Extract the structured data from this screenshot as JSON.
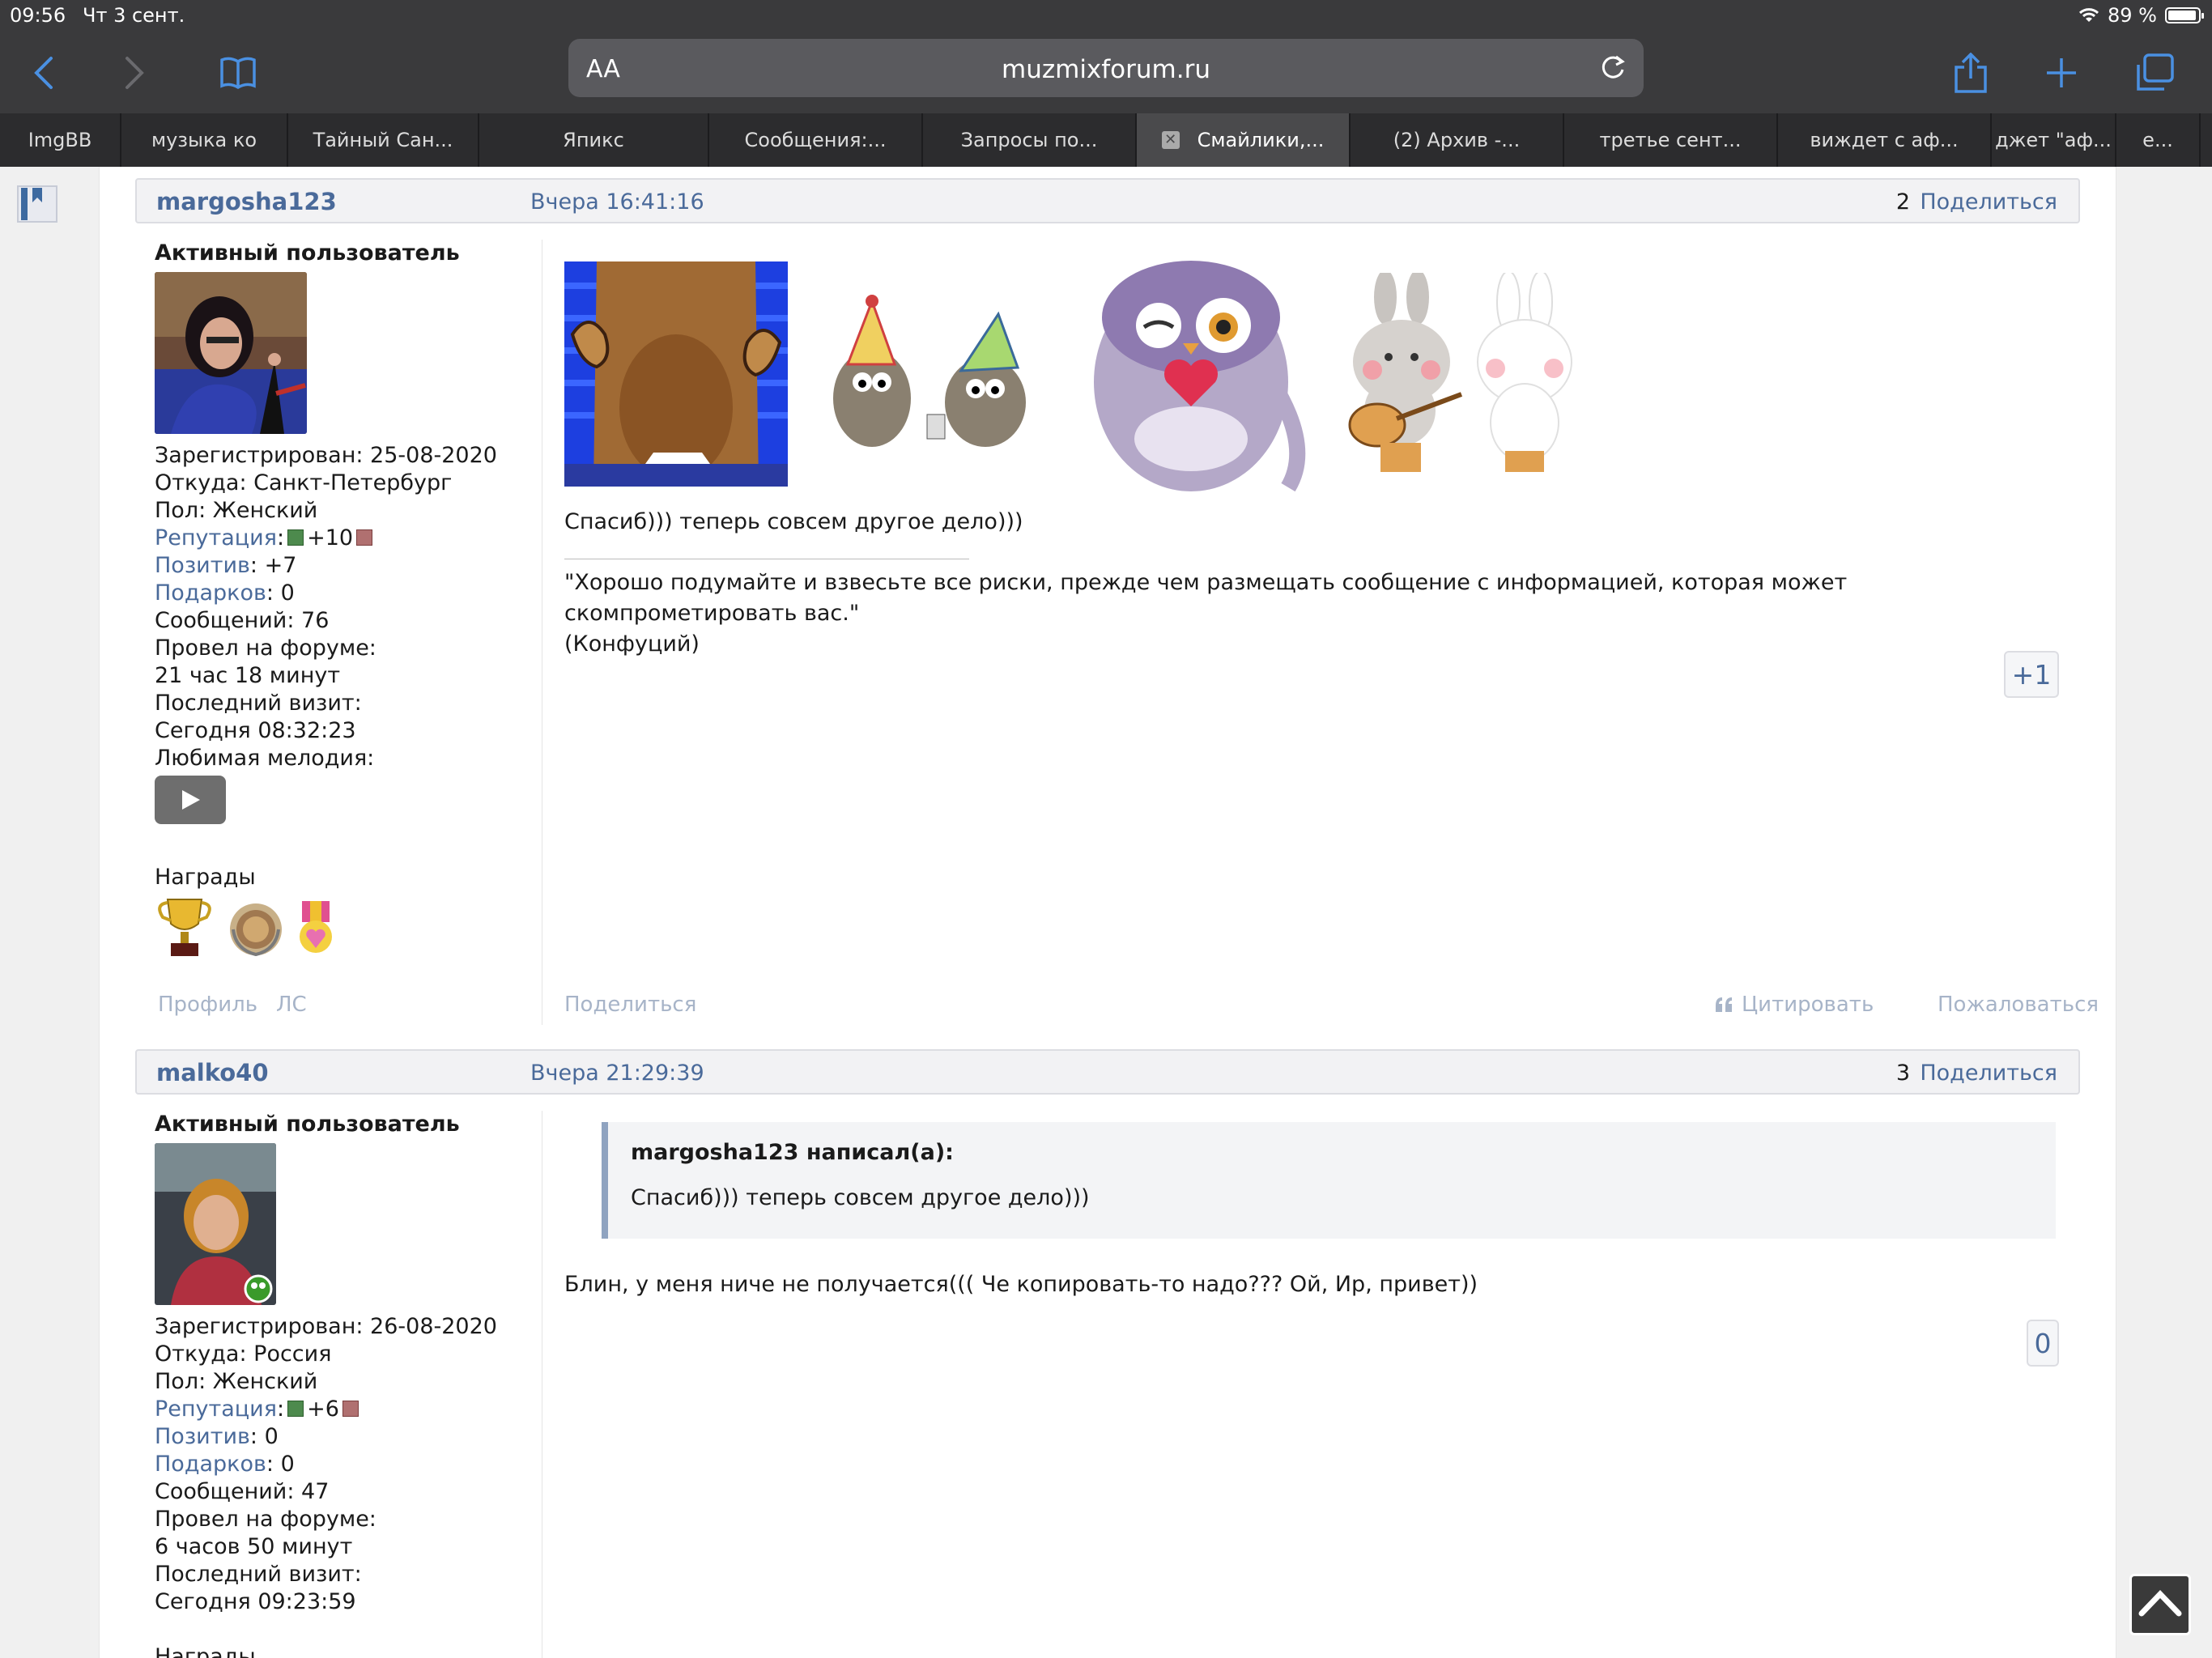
{
  "status": {
    "time": "09:56",
    "date": "Чт 3 сент.",
    "battery": "89 %"
  },
  "browser": {
    "text_size": "AA",
    "url": "muzmixforum.ru"
  },
  "tabs": [
    {
      "label": "ImgBB"
    },
    {
      "label": "музыка ко"
    },
    {
      "label": "Тайный Сан..."
    },
    {
      "label": "Япикс"
    },
    {
      "label": "Сообщения:..."
    },
    {
      "label": "Запросы по..."
    },
    {
      "label": "Смайлики,...",
      "active": true
    },
    {
      "label": "(2) Архив -..."
    },
    {
      "label": "третье сент..."
    },
    {
      "label": "виждет с аф..."
    },
    {
      "label": "джет \"аф..."
    },
    {
      "label": "е..."
    }
  ],
  "post1": {
    "author": "margosha123",
    "time": "Вчера 16:41:16",
    "number": "2",
    "share": "Поделиться",
    "rank": "Активный пользователь",
    "registered": "Зарегистрирован: 25-08-2020",
    "from": "Откуда: Санкт-Петербург",
    "gender": "Пол: Женский",
    "reputation_label": "Репутация",
    "reputation_value": "+10",
    "positive_label": "Позитив",
    "positive_value": ": +7",
    "gifts_label": "Подарков",
    "gifts_value": ": 0",
    "messages": "Сообщений: 76",
    "time_on_forum_label": "Провел на форуме:",
    "time_on_forum": "21 час 18 минут",
    "last_visit_label": "Последний визит:",
    "last_visit": "Сегодня 08:32:23",
    "melody": "Любимая мелодия:",
    "awards": "Награды",
    "text": "Спасиб))) теперь совсем другое дело)))",
    "signature": "\"Хорошо подумайте и взвесьте все риски, прежде чем размещать сообщение с информацией, которая может скомпрометировать вас.\"",
    "signature_author": "(Конфуций)",
    "votes": "+1",
    "profile": "Профиль",
    "pm": "ЛС",
    "footer_share": "Поделиться",
    "quote_action": "Цитировать",
    "report": "Пожаловаться"
  },
  "post2": {
    "author": "malko40",
    "time": "Вчера 21:29:39",
    "number": "3",
    "share": "Поделиться",
    "rank": "Активный пользователь",
    "registered": "Зарегистрирован: 26-08-2020",
    "from": "Откуда: Россия",
    "gender": "Пол: Женский",
    "reputation_label": "Репутация",
    "reputation_value": "+6",
    "positive_label": "Позитив",
    "positive_value": ": 0",
    "gifts_label": "Подарков",
    "gifts_value": ": 0",
    "messages": "Сообщений: 47",
    "time_on_forum_label": "Провел на форуме:",
    "time_on_forum": "6 часов 50 минут",
    "last_visit_label": "Последний визит:",
    "last_visit": "Сегодня 09:23:59",
    "awards": "Награды",
    "quote_author": "margosha123 написал(а):",
    "quote_text": "Спасиб))) теперь совсем другое дело)))",
    "text": "Блин, у меня ниче не получается((( Че копировать-то надо??? Ой, Ир, привет))",
    "votes": "0"
  }
}
